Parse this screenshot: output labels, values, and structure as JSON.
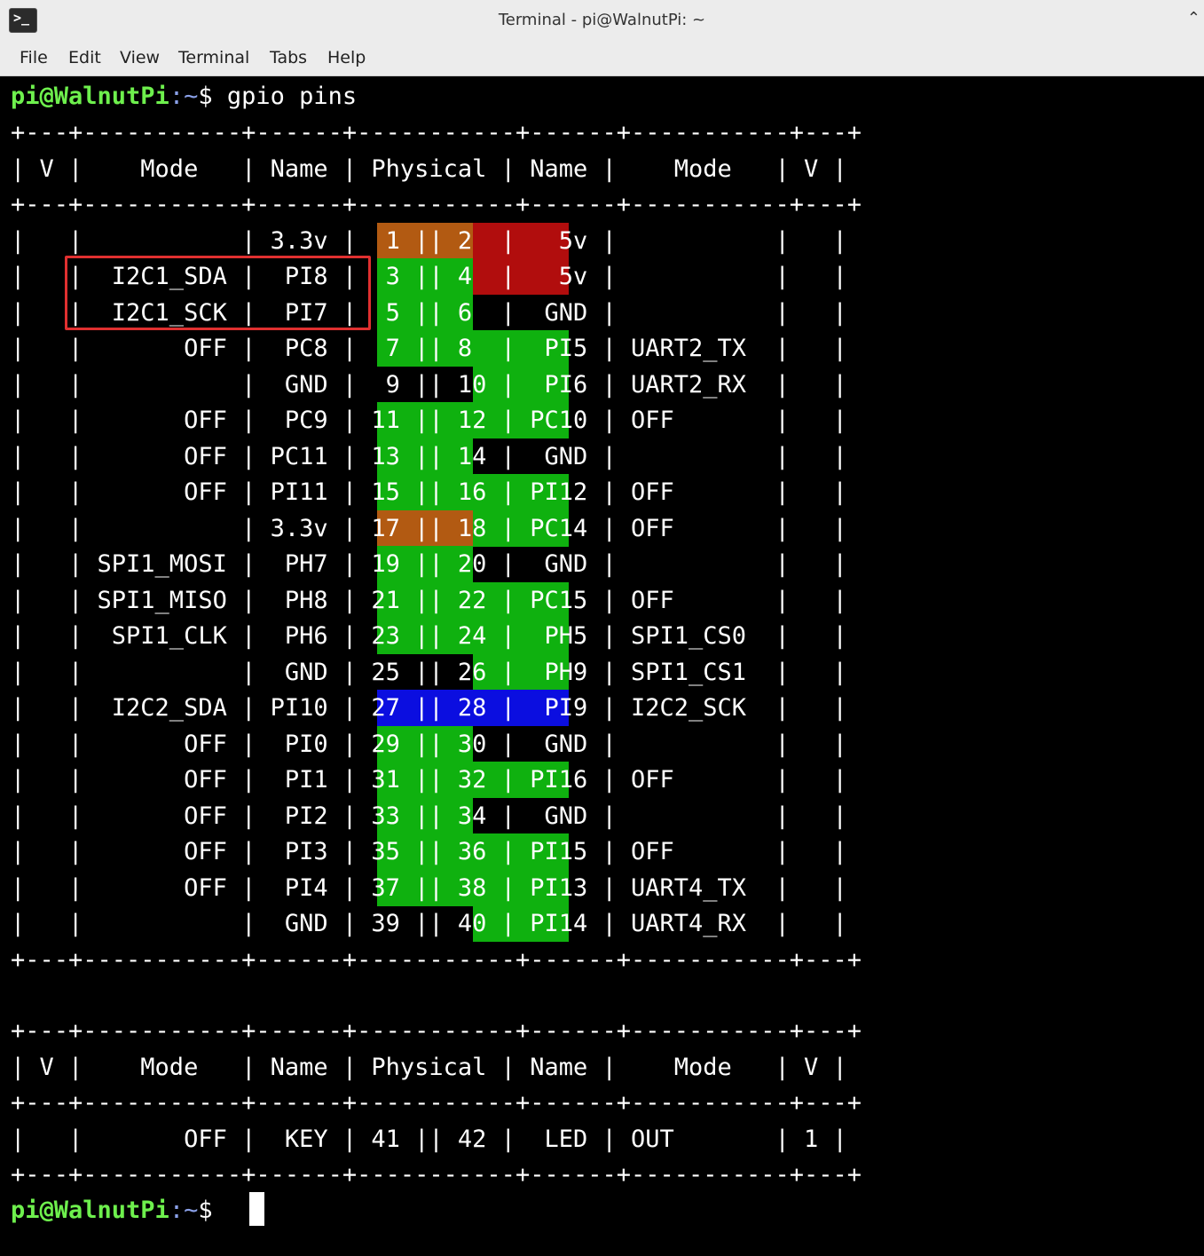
{
  "window": {
    "title": "Terminal - pi@WalnutPi: ~",
    "icon": "terminal-icon"
  },
  "menu": [
    "File",
    "Edit",
    "View",
    "Terminal",
    "Tabs",
    "Help"
  ],
  "prompt": {
    "user_host": "pi@WalnutPi",
    "path": ":~",
    "symbol": "$ ",
    "command": "gpio pins"
  },
  "table_border": "+---+-----------+------+-----------+------+-----------+---+",
  "table_header": "| V |    Mode   | Name | Physical | Name |    Mode   | V |",
  "table1_rows": [
    "|   |           | 3.3v |  1 || 2  |   5v |           |   |",
    "|   |  I2C1_SDA |  PI8 |  3 || 4  |   5v |           |   |",
    "|   |  I2C1_SCK |  PI7 |  5 || 6  |  GND |           |   |",
    "|   |       OFF |  PC8 |  7 || 8  |  PI5 | UART2_TX  |   |",
    "|   |           |  GND |  9 || 10 |  PI6 | UART2_RX  |   |",
    "|   |       OFF |  PC9 | 11 || 12 | PC10 | OFF       |   |",
    "|   |       OFF | PC11 | 13 || 14 |  GND |           |   |",
    "|   |       OFF | PI11 | 15 || 16 | PI12 | OFF       |   |",
    "|   |           | 3.3v | 17 || 18 | PC14 | OFF       |   |",
    "|   | SPI1_MOSI |  PH7 | 19 || 20 |  GND |           |   |",
    "|   | SPI1_MISO |  PH8 | 21 || 22 | PC15 | OFF       |   |",
    "|   |  SPI1_CLK |  PH6 | 23 || 24 |  PH5 | SPI1_CS0  |   |",
    "|   |           |  GND | 25 || 26 |  PH9 | SPI1_CS1  |   |",
    "|   |  I2C2_SDA | PI10 | 27 || 28 |  PI9 | I2C2_SCK  |   |",
    "|   |       OFF |  PI0 | 29 || 30 |  GND |           |   |",
    "|   |       OFF |  PI1 | 31 || 32 | PI16 | OFF       |   |",
    "|   |       OFF |  PI2 | 33 || 34 |  GND |           |   |",
    "|   |       OFF |  PI3 | 35 || 36 | PI15 | OFF       |   |",
    "|   |       OFF |  PI4 | 37 || 38 | PI13 | UART4_TX  |   |",
    "|   |           |  GND | 39 || 40 | PI14 | UART4_RX  |   |"
  ],
  "table2_rows": [
    "|   |       OFF |  KEY | 41 || 42 |  LED | OUT       | 1 |"
  ],
  "pin_colors": {
    "orange": "#b25a12",
    "red": "#b10d0d",
    "green": "#0fb10f",
    "blue": "#0b0ee0"
  },
  "left_pin_color": [
    "orange",
    "green",
    "green",
    "green",
    "none",
    "green",
    "green",
    "green",
    "orange",
    "green",
    "green",
    "green",
    "none",
    "blue",
    "green",
    "green",
    "green",
    "green",
    "green",
    "none"
  ],
  "right_pin_color": [
    "red",
    "red",
    "none",
    "green",
    "green",
    "green",
    "none",
    "green",
    "green",
    "none",
    "green",
    "green",
    "green",
    "blue",
    "none",
    "green",
    "none",
    "green",
    "green",
    "green"
  ],
  "highlight_box_color": "#e03030"
}
